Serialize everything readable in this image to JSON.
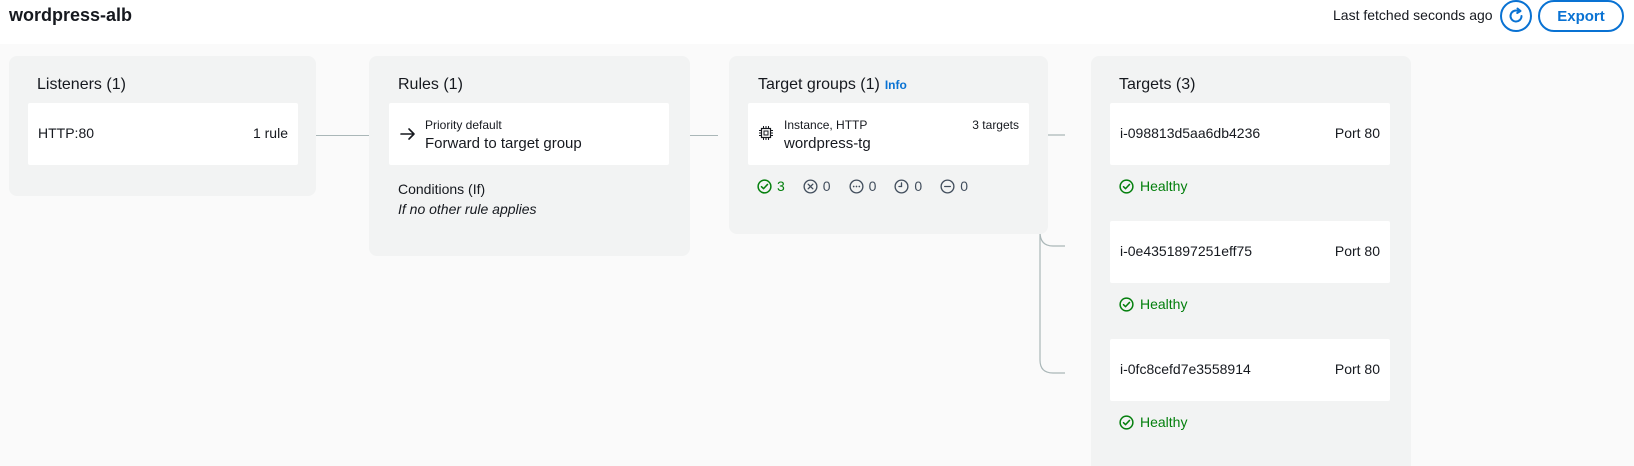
{
  "header": {
    "title": "wordpress-alb",
    "last_fetched": "Last fetched seconds ago",
    "export_label": "Export"
  },
  "listeners": {
    "title": "Listeners (1)",
    "item": {
      "protocol": "HTTP:80",
      "rules": "1 rule"
    }
  },
  "rules": {
    "title": "Rules (1)",
    "item": {
      "priority": "Priority default",
      "action": "Forward to target group"
    },
    "conditions_title": "Conditions (If)",
    "conditions_value": "If no other rule applies"
  },
  "target_groups": {
    "title": "Target groups (1)",
    "info_label": "Info",
    "item": {
      "type": "Instance, HTTP",
      "name": "wordpress-tg",
      "targets_count": "3 targets"
    },
    "stats": {
      "healthy": "3",
      "unhealthy": "0",
      "unused": "0",
      "draining": "0",
      "unavailable": "0"
    }
  },
  "targets": {
    "title": "Targets (3)",
    "items": [
      {
        "id": "i-098813d5aa6db4236",
        "port": "Port 80",
        "status": "Healthy"
      },
      {
        "id": "i-0e4351897251eff75",
        "port": "Port 80",
        "status": "Healthy"
      },
      {
        "id": "i-0fc8cefd7e3558914",
        "port": "Port 80",
        "status": "Healthy"
      }
    ]
  },
  "colors": {
    "accent": "#0972d3",
    "healthy": "#037f0c",
    "panel": "#f2f3f3",
    "connector": "#aab7b8"
  },
  "icons": [
    "refresh-icon",
    "arrow-right-icon",
    "chip-icon",
    "check-circle-icon",
    "x-circle-icon",
    "ellipsis-circle-icon",
    "clock-icon",
    "minus-circle-icon"
  ]
}
